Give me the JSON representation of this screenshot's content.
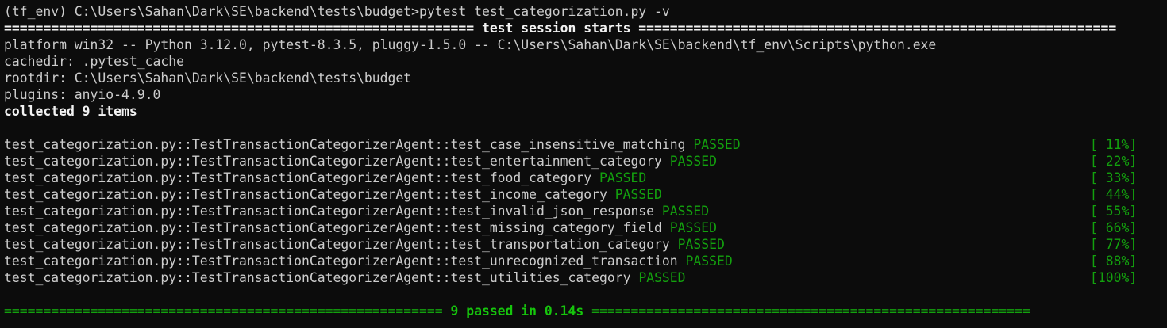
{
  "prompt": {
    "text": "(tf_env) C:\\Users\\Sahan\\Dark\\SE\\backend\\tests\\budget>pytest test_categorization.py -v"
  },
  "session_header": {
    "text": "============================================================ test session starts ============================================================="
  },
  "info_lines": [
    "platform win32 -- Python 3.12.0, pytest-8.3.5, pluggy-1.5.0 -- C:\\Users\\Sahan\\Dark\\SE\\backend\\tf_env\\Scripts\\python.exe",
    "cachedir: .pytest_cache",
    "rootdir: C:\\Users\\Sahan\\Dark\\SE\\backend\\tests\\budget",
    "plugins: anyio-4.9.0"
  ],
  "collected": "collected 9 items",
  "tests": [
    {
      "name": "test_categorization.py::TestTransactionCategorizerAgent::test_case_insensitive_matching",
      "status": "PASSED",
      "progress": "[ 11%]"
    },
    {
      "name": "test_categorization.py::TestTransactionCategorizerAgent::test_entertainment_category",
      "status": "PASSED",
      "progress": "[ 22%]"
    },
    {
      "name": "test_categorization.py::TestTransactionCategorizerAgent::test_food_category",
      "status": "PASSED",
      "progress": "[ 33%]"
    },
    {
      "name": "test_categorization.py::TestTransactionCategorizerAgent::test_income_category",
      "status": "PASSED",
      "progress": "[ 44%]"
    },
    {
      "name": "test_categorization.py::TestTransactionCategorizerAgent::test_invalid_json_response",
      "status": "PASSED",
      "progress": "[ 55%]"
    },
    {
      "name": "test_categorization.py::TestTransactionCategorizerAgent::test_missing_category_field",
      "status": "PASSED",
      "progress": "[ 66%]"
    },
    {
      "name": "test_categorization.py::TestTransactionCategorizerAgent::test_transportation_category",
      "status": "PASSED",
      "progress": "[ 77%]"
    },
    {
      "name": "test_categorization.py::TestTransactionCategorizerAgent::test_unrecognized_transaction",
      "status": "PASSED",
      "progress": "[ 88%]"
    },
    {
      "name": "test_categorization.py::TestTransactionCategorizerAgent::test_utilities_category",
      "status": "PASSED",
      "progress": "[100%]"
    }
  ],
  "summary": {
    "left_rule": "========================================================",
    "text": " 9 passed in 0.14s ",
    "right_rule": "========================================================"
  },
  "colors": {
    "background": "#0c0c0c",
    "text": "#cccccc",
    "pass": "#13a10e",
    "summary": "#16c60c"
  }
}
